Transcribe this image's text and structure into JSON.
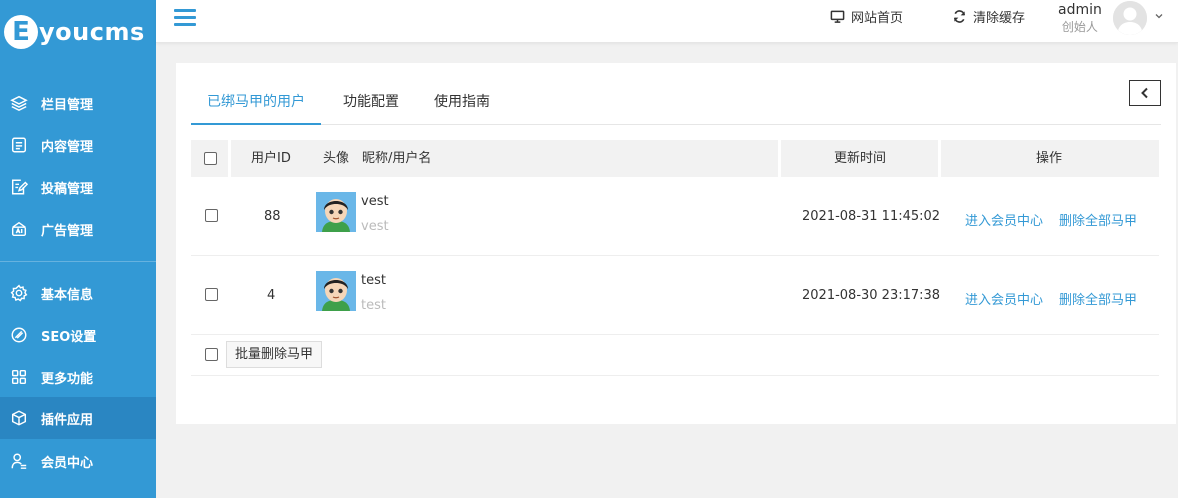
{
  "logo": {
    "letter": "E",
    "text": "youcms"
  },
  "sidebar": {
    "items": [
      {
        "label": "栏目管理",
        "icon": "layers-icon"
      },
      {
        "label": "内容管理",
        "icon": "document-icon"
      },
      {
        "label": "投稿管理",
        "icon": "edit-icon"
      },
      {
        "label": "广告管理",
        "icon": "ad-icon"
      },
      {
        "label": "基本信息",
        "icon": "gear-icon"
      },
      {
        "label": "SEO设置",
        "icon": "seo-icon"
      },
      {
        "label": "更多功能",
        "icon": "grid-icon"
      },
      {
        "label": "插件应用",
        "icon": "cube-icon",
        "active": true
      },
      {
        "label": "会员中心",
        "icon": "user-icon"
      }
    ]
  },
  "header": {
    "site_home": "网站首页",
    "clear_cache": "清除缓存",
    "user_name": "admin",
    "user_role": "创始人"
  },
  "tabs": [
    {
      "label": "已绑马甲的用户",
      "active": true
    },
    {
      "label": "功能配置"
    },
    {
      "label": "使用指南"
    }
  ],
  "table": {
    "headers": {
      "user_id": "用户ID",
      "avatar": "头像",
      "nickname": "昵称/用户名",
      "updated": "更新时间",
      "actions": "操作"
    },
    "rows": [
      {
        "id": "88",
        "nickname": "vest",
        "username": "vest",
        "updated": "2021-08-31 11:45:02",
        "action1": "进入会员中心",
        "action2": "删除全部马甲"
      },
      {
        "id": "4",
        "nickname": "test",
        "username": "test",
        "updated": "2021-08-30 23:17:38",
        "action1": "进入会员中心",
        "action2": "删除全部马甲"
      }
    ],
    "batch_delete": "批量删除马甲"
  },
  "colors": {
    "primary": "#3399d5",
    "sidebar_active": "#2a86c2"
  }
}
